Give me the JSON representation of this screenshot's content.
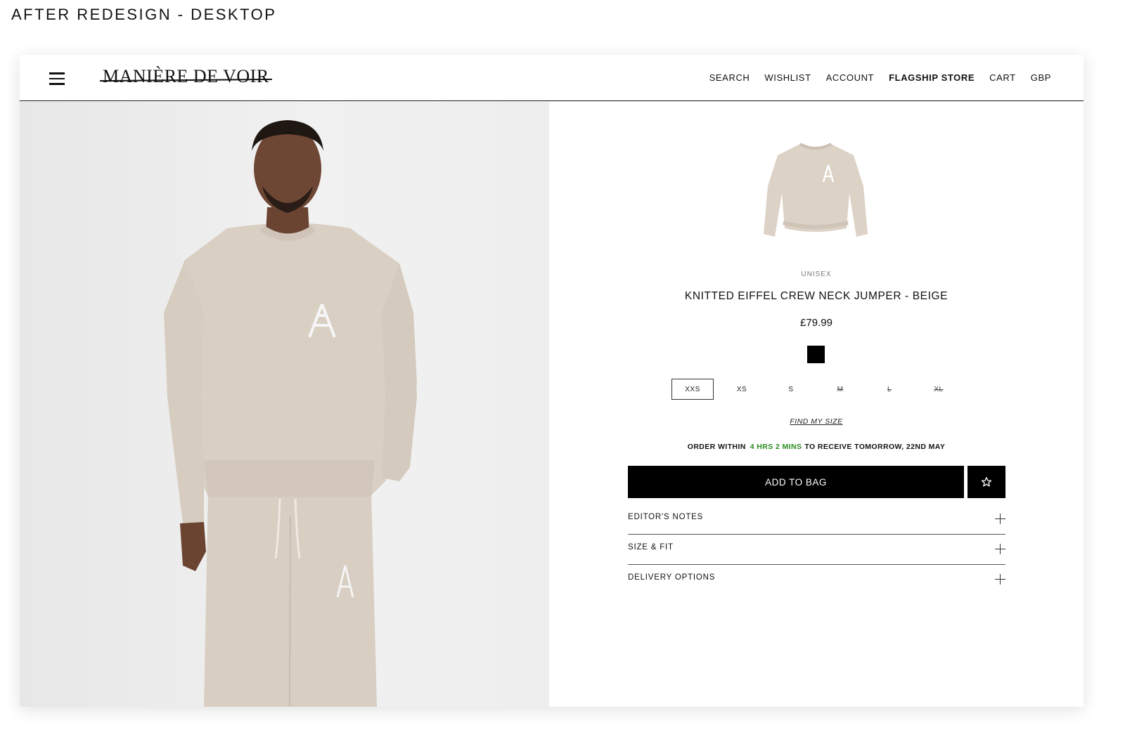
{
  "caption": "AFTER REDESIGN - DESKTOP",
  "brand": {
    "logo_text": "MANIÈRE DE VOIR"
  },
  "nav": {
    "search": "SEARCH",
    "wishlist": "WISHLIST",
    "account": "ACCOUNT",
    "flagship_store": "FLAGSHIP STORE",
    "cart": "CART",
    "currency": "GBP"
  },
  "product": {
    "gender": "UNISEX",
    "title": "KNITTED EIFFEL CREW NECK JUMPER - BEIGE",
    "price": "£79.99",
    "color_swatch": "#000000",
    "sizes": [
      {
        "label": "XXS",
        "state": "selected"
      },
      {
        "label": "XS",
        "state": "available"
      },
      {
        "label": "S",
        "state": "available"
      },
      {
        "label": "M",
        "state": "out-of-stock"
      },
      {
        "label": "L",
        "state": "out-of-stock"
      },
      {
        "label": "XL",
        "state": "out-of-stock"
      }
    ],
    "find_my_size": "FIND MY SIZE"
  },
  "delivery": {
    "prefix": "ORDER WITHIN",
    "countdown": "4 HRS 2 MINS",
    "suffix": "TO RECEIVE TOMORROW, 22ND MAY",
    "countdown_color": "#2a8a1e"
  },
  "actions": {
    "add_to_bag": "ADD TO BAG",
    "wishlist_icon": "star-icon"
  },
  "accordion": [
    "EDITOR'S NOTES",
    "SIZE & FIT",
    "DELIVERY OPTIONS"
  ],
  "colors": {
    "knit_beige": "#d9cfc3",
    "button_black": "#000000"
  }
}
